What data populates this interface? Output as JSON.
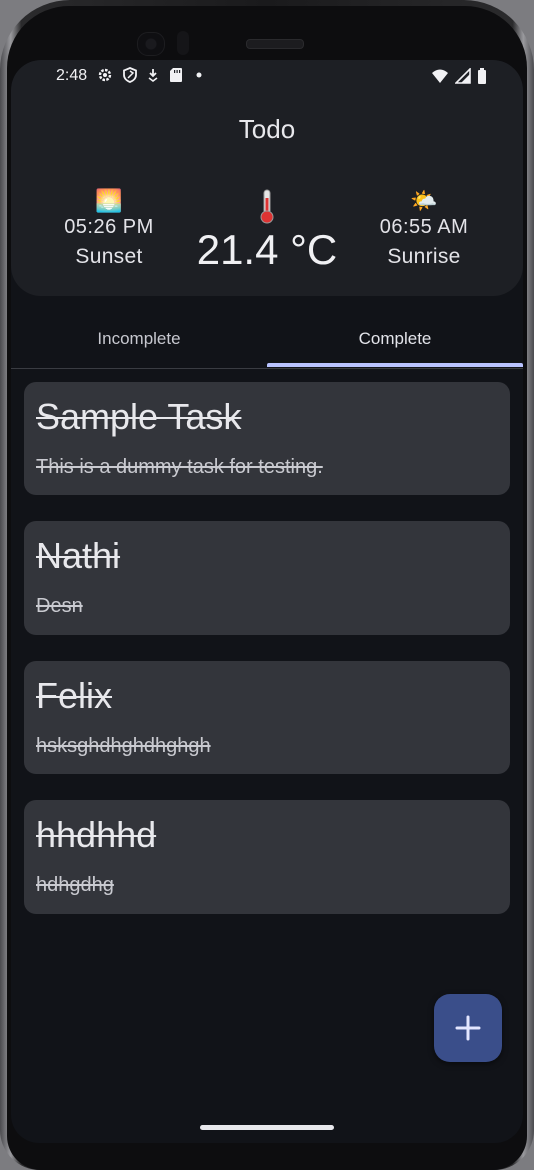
{
  "status_bar": {
    "time": "2:48",
    "left_icons": [
      "gear-icon",
      "shield-icon",
      "download-badge-icon",
      "sd-card-icon",
      "dot-icon"
    ],
    "right_icons": [
      "wifi-icon",
      "signal-icon",
      "battery-icon"
    ]
  },
  "app": {
    "title": "Todo"
  },
  "weather": {
    "sunset": {
      "emoji": "🌅",
      "time": "05:26 PM",
      "label": "Sunset"
    },
    "temperature": {
      "emoji": "🌡️",
      "value": "21.4 °C"
    },
    "sunrise": {
      "emoji": "🌤️",
      "time": "06:55 AM",
      "label": "Sunrise"
    }
  },
  "tabs": [
    {
      "label": "Incomplete",
      "selected": false
    },
    {
      "label": "Complete",
      "selected": true
    }
  ],
  "tasks": [
    {
      "title": "Sample Task",
      "description": "This is a dummy task for testing.",
      "completed": true
    },
    {
      "title": "Nathi",
      "description": "Desn",
      "completed": true
    },
    {
      "title": "Felix",
      "description": "hsksghdhghdhghgh",
      "completed": true
    },
    {
      "title": "hhdhhd",
      "description": "hdhgdhg",
      "completed": true
    }
  ],
  "fab": {
    "icon": "plus-icon"
  },
  "colors": {
    "background": "#111318",
    "header_surface": "#1d1f24",
    "card_surface": "#33353b",
    "accent": "#b9c3ff",
    "fab": "#3a4e8a"
  }
}
